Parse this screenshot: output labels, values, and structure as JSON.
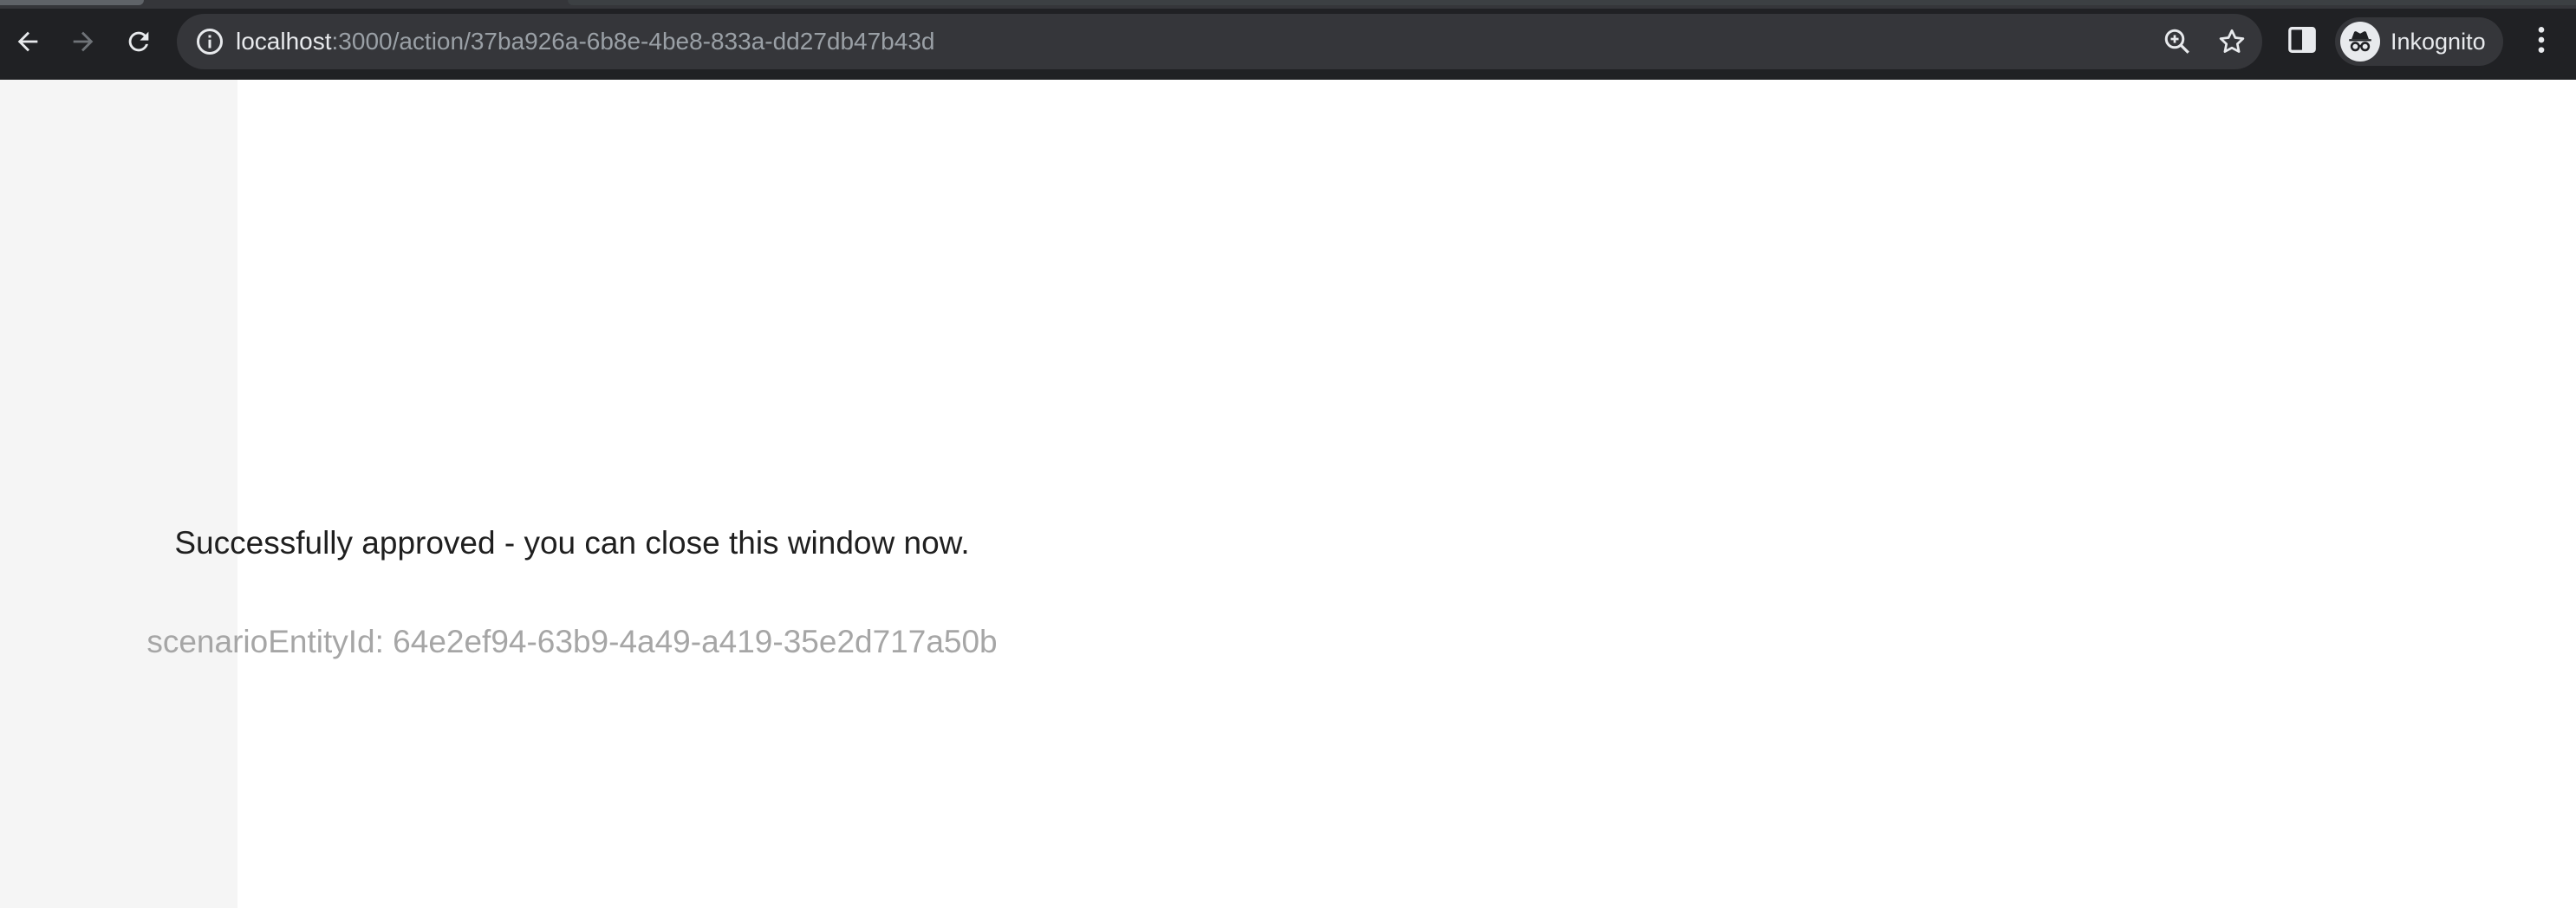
{
  "browser": {
    "url_host": "localhost",
    "url_path": ":3000/action/37ba926a-6b8e-4be8-833a-dd27db47b43d",
    "profile_label": "Inkognito",
    "icons": {
      "back": "arrow-left-icon",
      "forward": "arrow-right-icon",
      "reload": "reload-icon",
      "info": "info-icon",
      "zoom": "zoom-in-icon",
      "bookmark": "star-icon",
      "side_panel": "side-panel-icon",
      "incognito": "incognito-icon",
      "menu": "kebab-menu-icon"
    }
  },
  "page": {
    "message": "Successfully approved - you can close this window now.",
    "entity_id": "scenarioEntityId: 64e2ef94-63b9-4a49-a419-35e2d717a50b"
  },
  "colors": {
    "chrome_bg": "#202124",
    "omnibox_bg": "#35363a",
    "sidebar_bg": "#f5f5f5",
    "message_text": "#1f1f1f",
    "entity_id_text": "#a6a6a6"
  }
}
